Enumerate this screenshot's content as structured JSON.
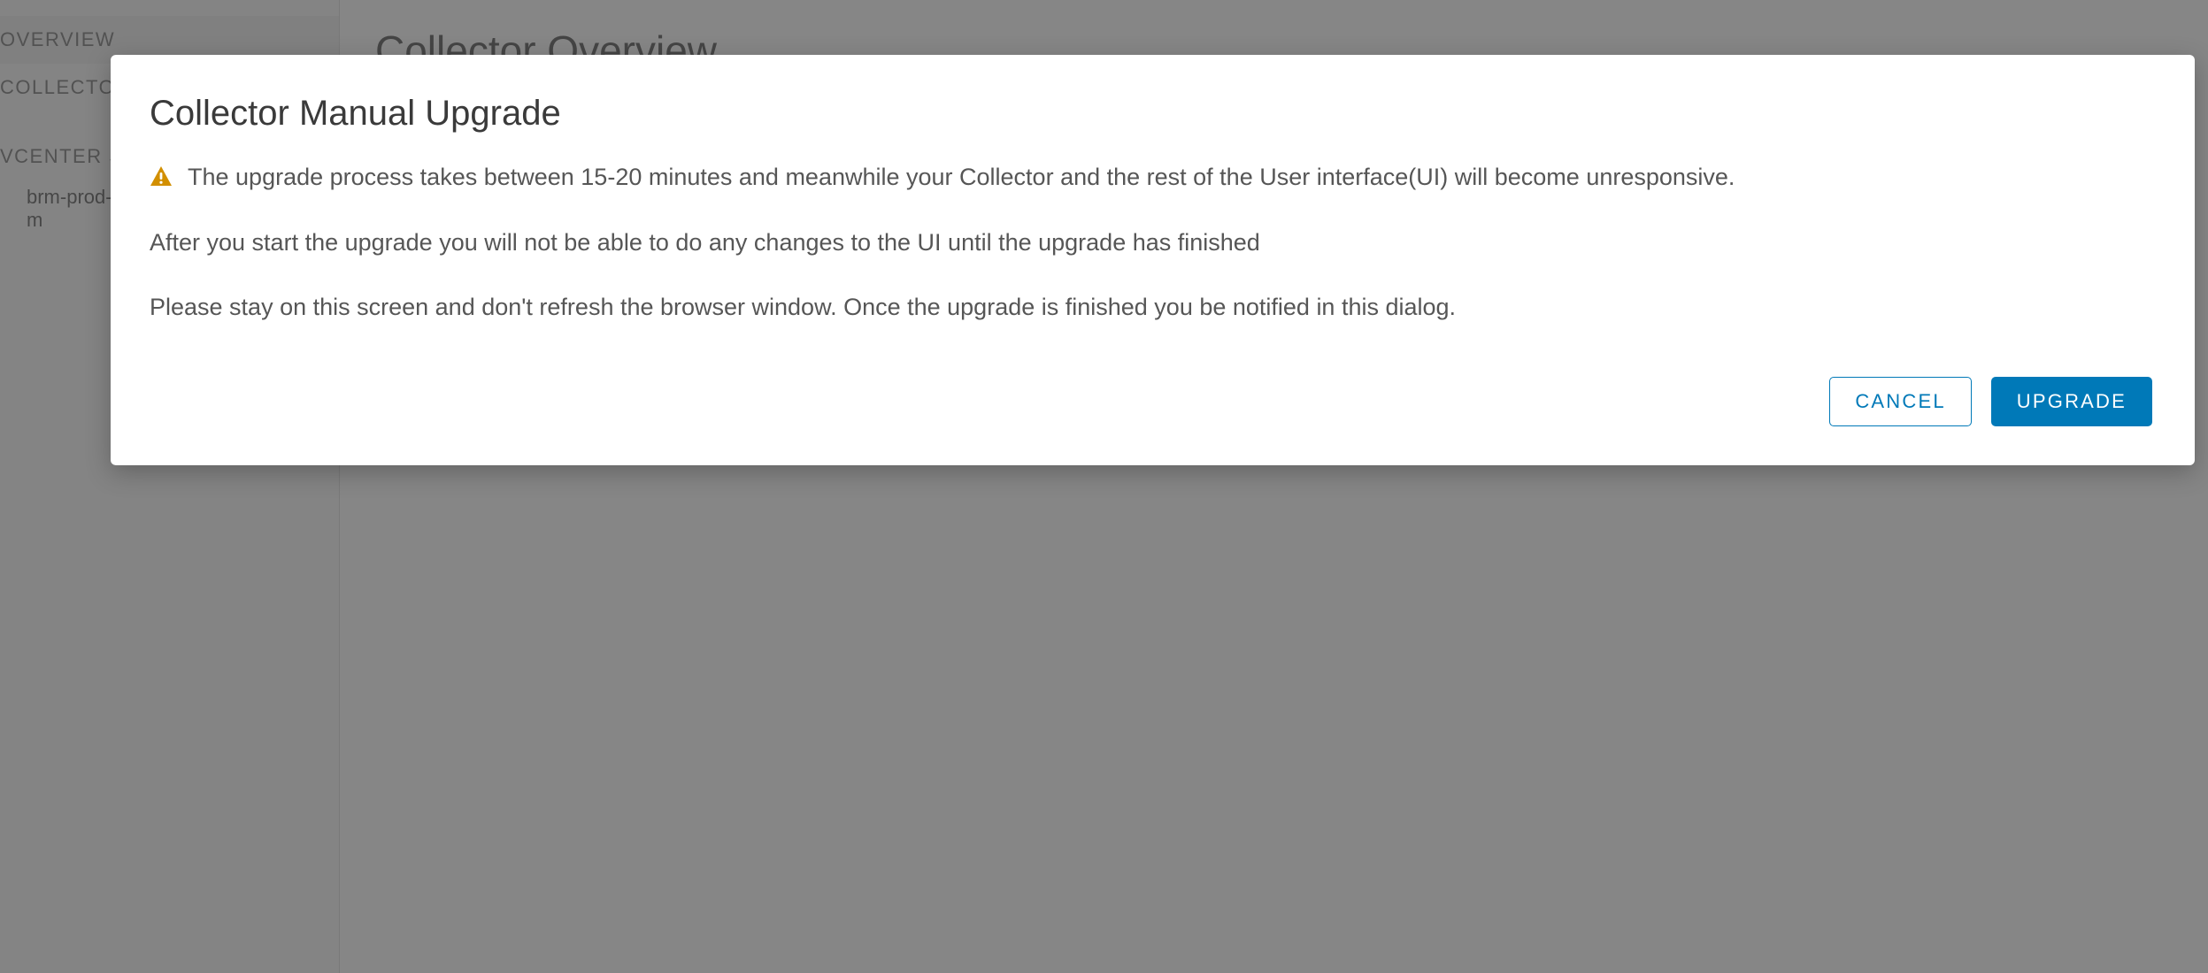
{
  "sidebar": {
    "overview_label": "OVERVIEW",
    "collector_label": "COLLECTOR",
    "vcenter_section_label": "VCENTER SE",
    "vcenter_item_label": "brm-prod-\nm"
  },
  "main": {
    "page_title": "Collector Overview"
  },
  "modal": {
    "title": "Collector Manual Upgrade",
    "warning_para": "The upgrade process takes between 15-20 minutes and meanwhile your Collector and the rest of the User interface(UI) will become unresponsive.",
    "para_2": "After you start the upgrade you will not be able to do any changes to the UI until the upgrade has finished",
    "para_3": "Please stay on this screen and don't refresh the browser window. Once the upgrade is finished you be notified in this dialog.",
    "cancel_label": "CANCEL",
    "upgrade_label": "UPGRADE"
  },
  "icons": {
    "warning": "warning-triangle"
  },
  "colors": {
    "primary": "#0079b8",
    "warning": "#d28f00"
  }
}
